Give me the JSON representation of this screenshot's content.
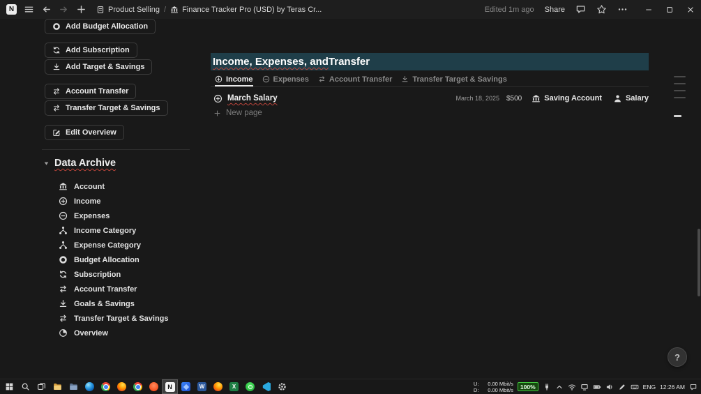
{
  "window": {
    "crumb1": "Product Selling",
    "crumb_sep": "/",
    "crumb2": "Finance Tracker Pro (USD) by Teras Cr...",
    "edited": "Edited 1m ago",
    "share": "Share"
  },
  "left": {
    "buttons": [
      "Add Budget Allocation",
      "Add Subscription",
      "Add Target & Savings",
      "Account Transfer",
      "Transfer Target & Savings",
      "Edit Overview"
    ],
    "archive_title": "Data Archive",
    "archive_items": [
      "Account",
      "Income",
      "Expenses",
      "Income Category",
      "Expense Category",
      "Budget Allocation",
      "Subscription",
      "Account Transfer",
      "Goals & Savings",
      "Transfer Target & Savings",
      "Overview"
    ]
  },
  "main": {
    "heading_underlined": "Income, Expenses, and",
    "heading_rest": " Transfer",
    "tabs": [
      "Income",
      "Expenses",
      "Account Transfer",
      "Transfer Target & Savings"
    ],
    "active_tab": "Income",
    "row": {
      "title": "March Salary",
      "date": "March 18, 2025",
      "amount": "$500",
      "account": "Saving Account",
      "category": "Salary"
    },
    "new_page": "New page"
  },
  "help": {
    "label": "?"
  },
  "tray": {
    "u_label": "U:",
    "u_value": "0.00 Mbit/s",
    "d_label": "D:",
    "d_value": "0.00 Mbit/s",
    "battery": "100%",
    "lang": "ENG",
    "time": "12:26 AM"
  },
  "icons": {
    "notion_letter": "N",
    "word_letter": "W",
    "excel_letter": "X"
  },
  "colors": {
    "background": "#191919",
    "heading_highlight": "#1f3e49",
    "battery_green": "#43c63f",
    "spellcheck_red": "#b8443a"
  }
}
